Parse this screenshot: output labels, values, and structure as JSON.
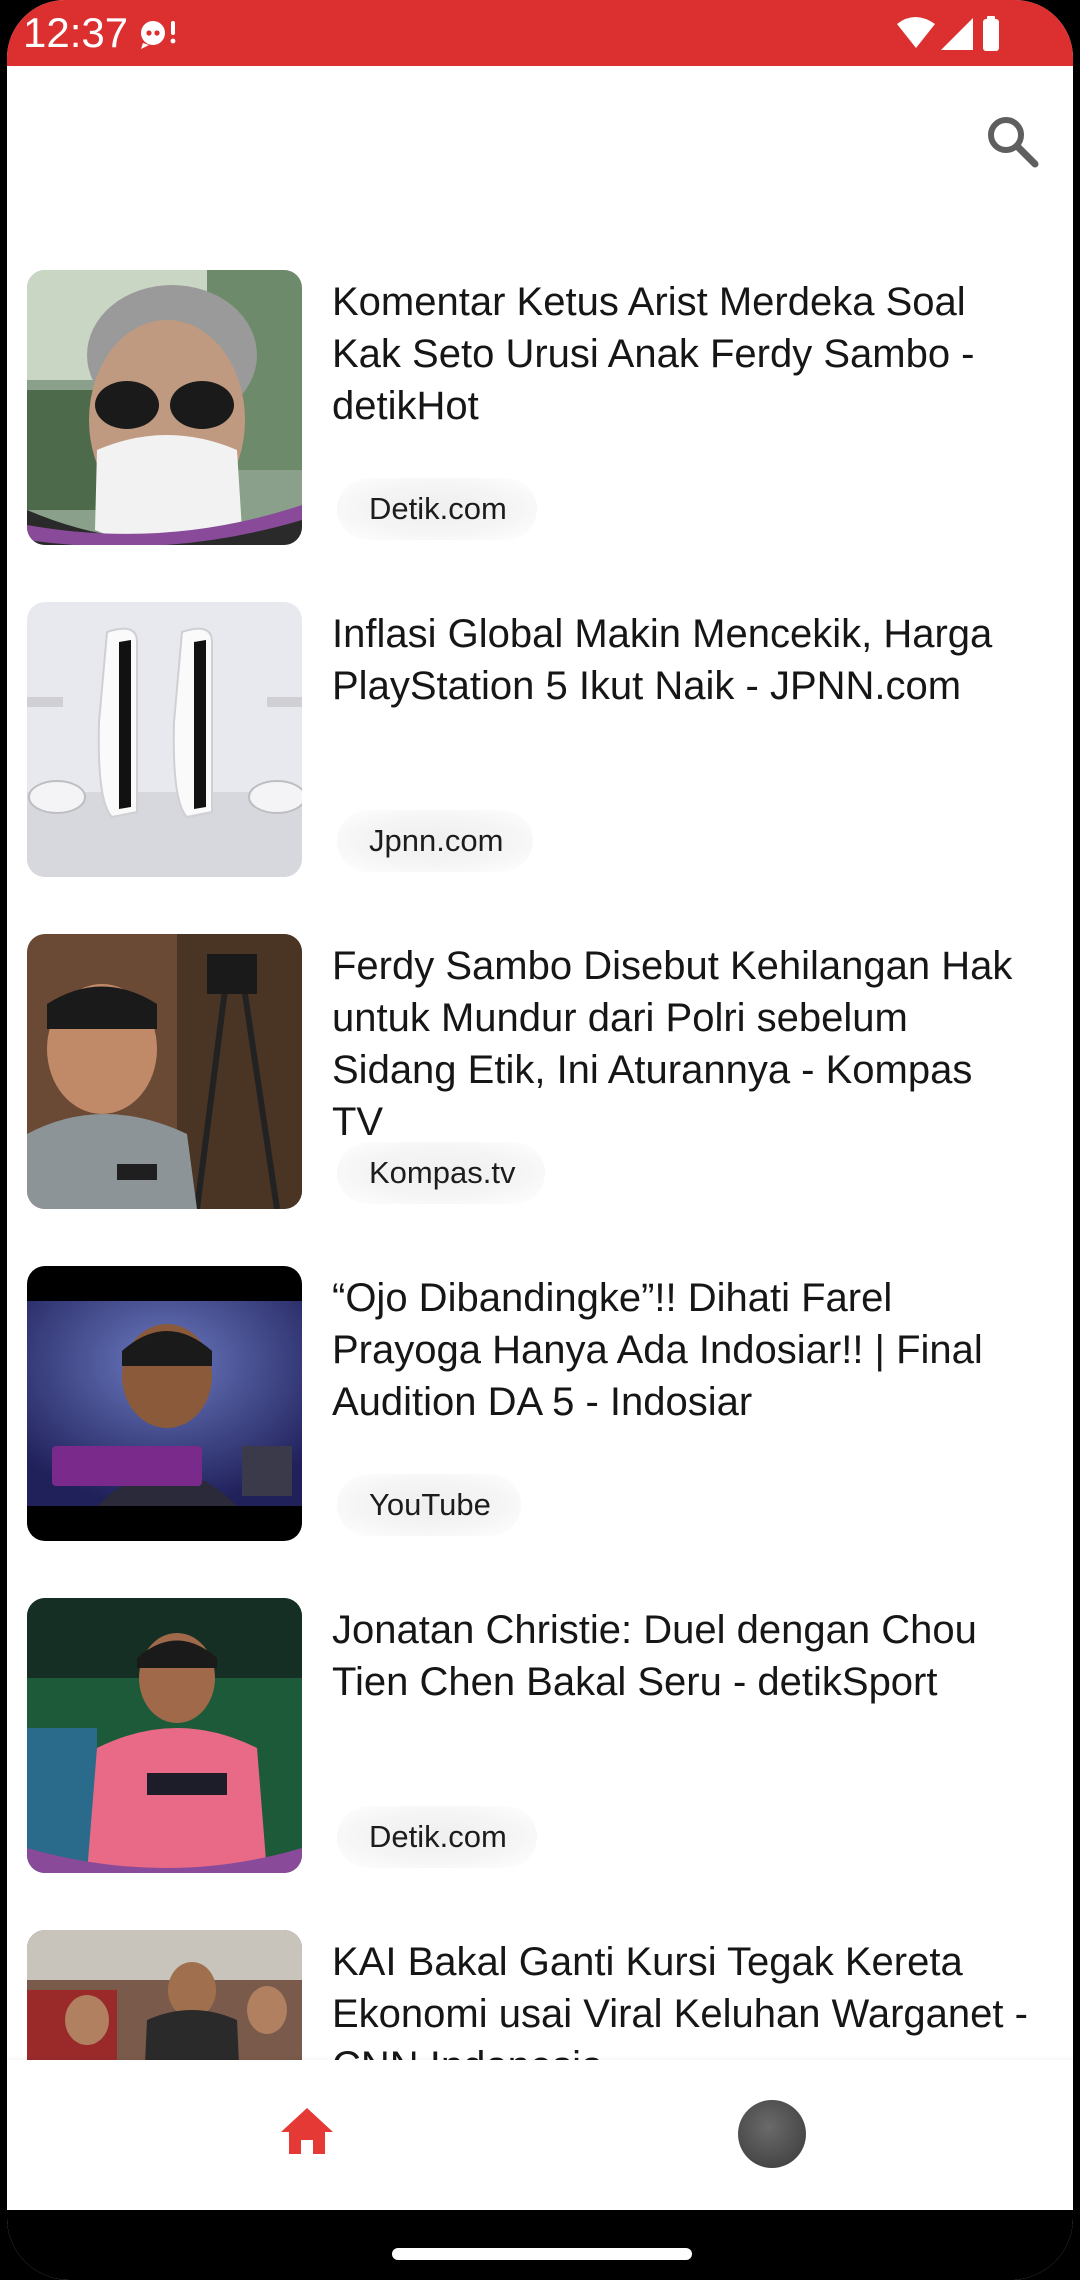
{
  "status_bar": {
    "time": "12:37",
    "background": "#dc3030"
  },
  "app_bar": {
    "search_icon": "search-icon"
  },
  "articles": [
    {
      "title": "Komentar Ketus Arist Merdeka Soal Kak Seto Urusi Anak Ferdy Sambo - detikHot",
      "source": "Detik.com"
    },
    {
      "title": "Inflasi Global Makin Mencekik, Harga PlayStation 5 Ikut Naik - JPNN.com",
      "source": "Jpnn.com"
    },
    {
      "title": "Ferdy Sambo Disebut Kehilangan Hak untuk Mundur dari Polri sebelum Sidang Etik, Ini Aturannya - Kompas TV",
      "source": "Kompas.tv"
    },
    {
      "title": "“Ojo Dibandingke”!! Dihati Farel Prayoga Hanya Ada Indosiar!! | Final Audition DA 5 - Indosiar",
      "source": "YouTube"
    },
    {
      "title": "Jonatan Christie: Duel dengan Chou Tien Chen Bakal Seru - detikSport",
      "source": "Detik.com"
    },
    {
      "title": "KAI Bakal Ganti Kursi Tegak Kereta Ekonomi usai Viral Keluhan Warganet - CNN Indonesia",
      "source": ""
    }
  ],
  "bottom_nav": {
    "home_icon": "home-icon",
    "profile_icon": "profile-avatar",
    "active_color": "#e53935"
  }
}
